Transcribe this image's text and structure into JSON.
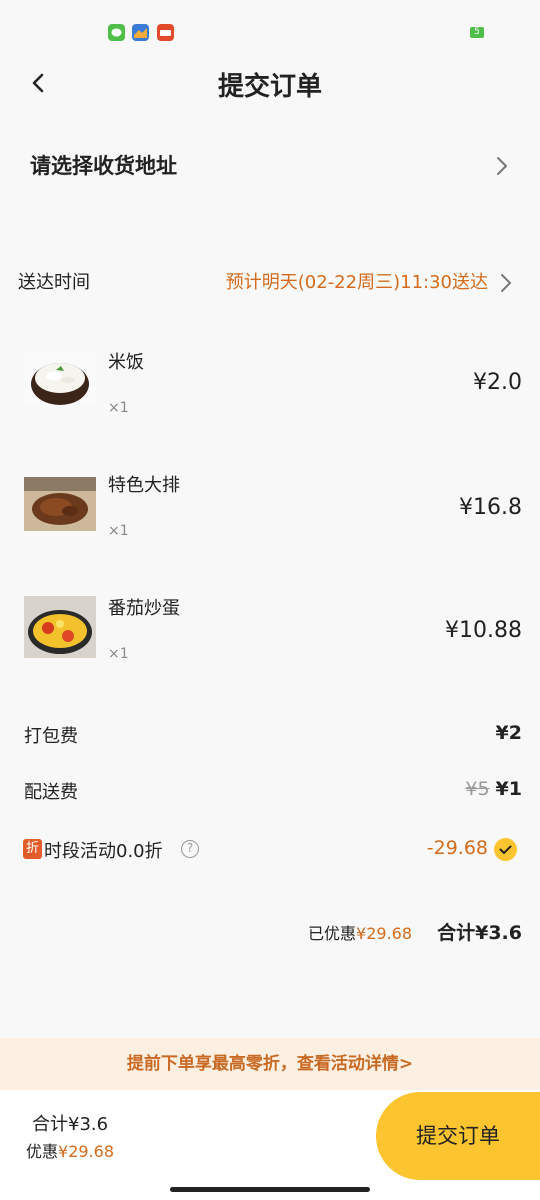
{
  "status_bar": {
    "battery_level": "5"
  },
  "header": {
    "title": "提交订单"
  },
  "address": {
    "label": "请选择收货地址"
  },
  "delivery": {
    "label": "送达时间",
    "value": "预计明天(02-22周三)11:30送达"
  },
  "items": [
    {
      "name": "米饭",
      "qty": "×1",
      "price": "¥2.0",
      "image": "rice-bowl-photo"
    },
    {
      "name": "特色大排",
      "qty": "×1",
      "price": "¥16.8",
      "image": "pork-chop-photo"
    },
    {
      "name": "番茄炒蛋",
      "qty": "×1",
      "price": "¥10.88",
      "image": "tomato-egg-photo"
    }
  ],
  "fees": {
    "packaging_label": "打包费",
    "packaging_value": "¥2",
    "delivery_label": "配送费",
    "delivery_original": "¥5",
    "delivery_value": "¥1"
  },
  "promotion": {
    "badge": "折",
    "label": "时段活动0.0折",
    "help_symbol": "?",
    "value": "-29.68",
    "selected": true
  },
  "summary": {
    "saved_prefix": "已优惠",
    "saved_amount": "¥29.68",
    "total": "合计¥3.6"
  },
  "banner": {
    "text": "提前下单享最高零折，查看活动详情>"
  },
  "footer": {
    "total": "合计¥3.6",
    "saved_prefix": "优惠",
    "saved_amount": "¥29.68",
    "submit_label": "提交订单"
  },
  "colors": {
    "accent_orange": "#d46b1c",
    "button_yellow": "#fcc52f",
    "banner_bg": "#fdf0e3"
  }
}
